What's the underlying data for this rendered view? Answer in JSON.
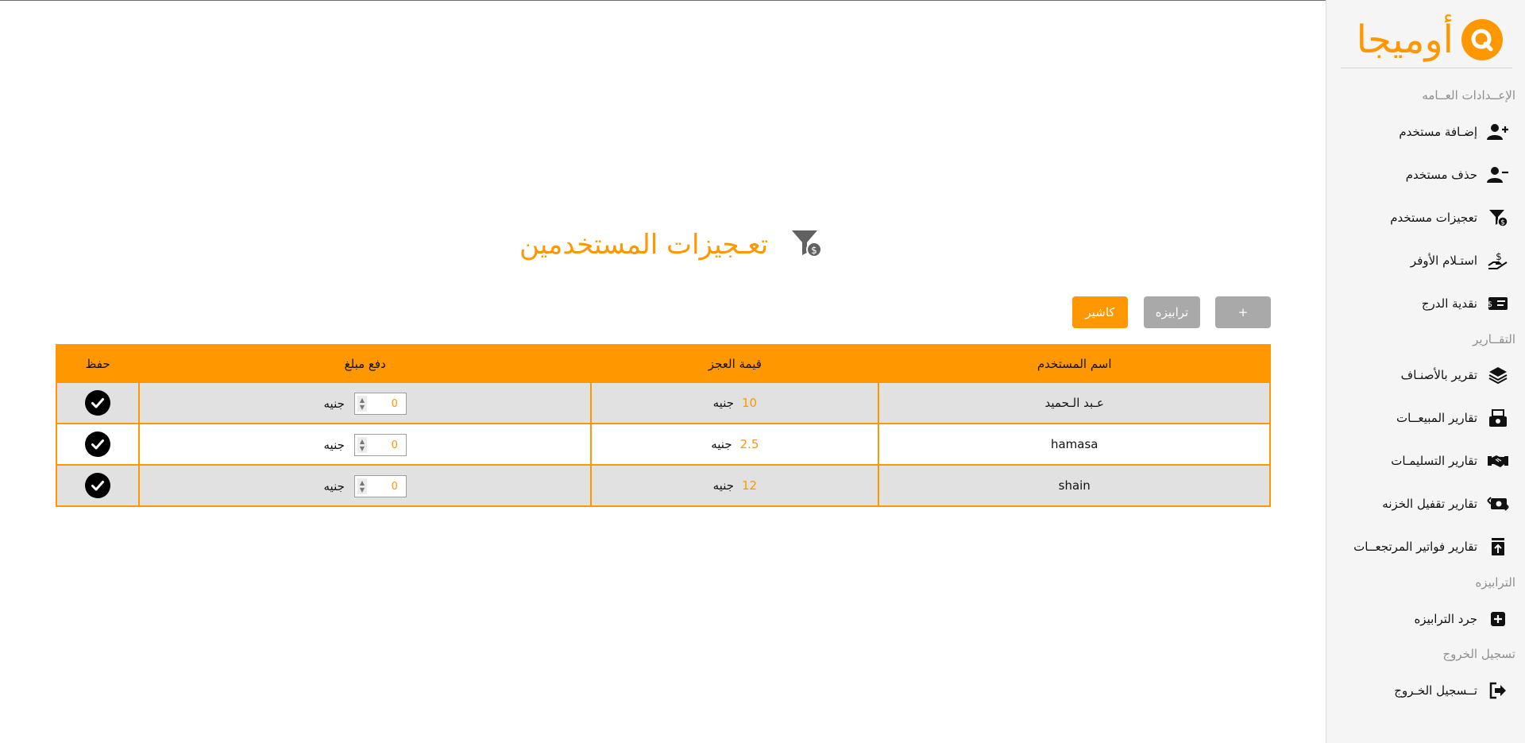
{
  "brand": {
    "name": "أوميجا",
    "color": "#ff9800"
  },
  "sidebar": {
    "sections": [
      {
        "label": "الإعــدادات العــامه"
      },
      {
        "label": "التقــارير"
      },
      {
        "label": "الترابيزه"
      },
      {
        "label": "تسجيل الخروج"
      }
    ],
    "items": [
      {
        "label": "إضـافة مستخدم",
        "icon": "user-plus-icon"
      },
      {
        "label": "حذف مستخدم",
        "icon": "user-minus-icon"
      },
      {
        "label": "تعجيزات مستخدم",
        "icon": "filter-dollar-icon"
      },
      {
        "label": "استـلام الأوفر",
        "icon": "hand-dollar-icon"
      },
      {
        "label": "نقدية الدرج",
        "icon": "money-bill-icon"
      },
      {
        "label": "تقرير بالأصنـاف",
        "icon": "layers-icon"
      },
      {
        "label": "تقارير المبيعــات",
        "icon": "cash-register-icon"
      },
      {
        "label": "تقارير التسليمـات",
        "icon": "handshake-icon"
      },
      {
        "label": "تقارير تقفيل الخزنه",
        "icon": "money-exchange-icon"
      },
      {
        "label": "تقارير فواتير المرتجعــات",
        "icon": "receipt-upload-icon"
      },
      {
        "label": "جرد الترابيزه",
        "icon": "plus-square-icon"
      },
      {
        "label": "تــسجيل الخـروج",
        "icon": "sign-out-icon"
      }
    ]
  },
  "page": {
    "title": "تعـجيزات المستخدمين",
    "icon": "filter-dollar-icon"
  },
  "toolbar": {
    "cashier_label": "كاشير",
    "table_label": "ترابيزه",
    "add_label": "+"
  },
  "table": {
    "headers": [
      "اسم المستخدم",
      "قيمة العجز",
      "دفع مبلغ",
      "حفظ"
    ],
    "currency": "جنيه",
    "rows": [
      {
        "name": "عـبد الـحميد",
        "deficit": "10",
        "payment": "0"
      },
      {
        "name": "hamasa",
        "deficit": "2.5",
        "payment": "0"
      },
      {
        "name": "shain",
        "deficit": "12",
        "payment": "0"
      }
    ]
  }
}
